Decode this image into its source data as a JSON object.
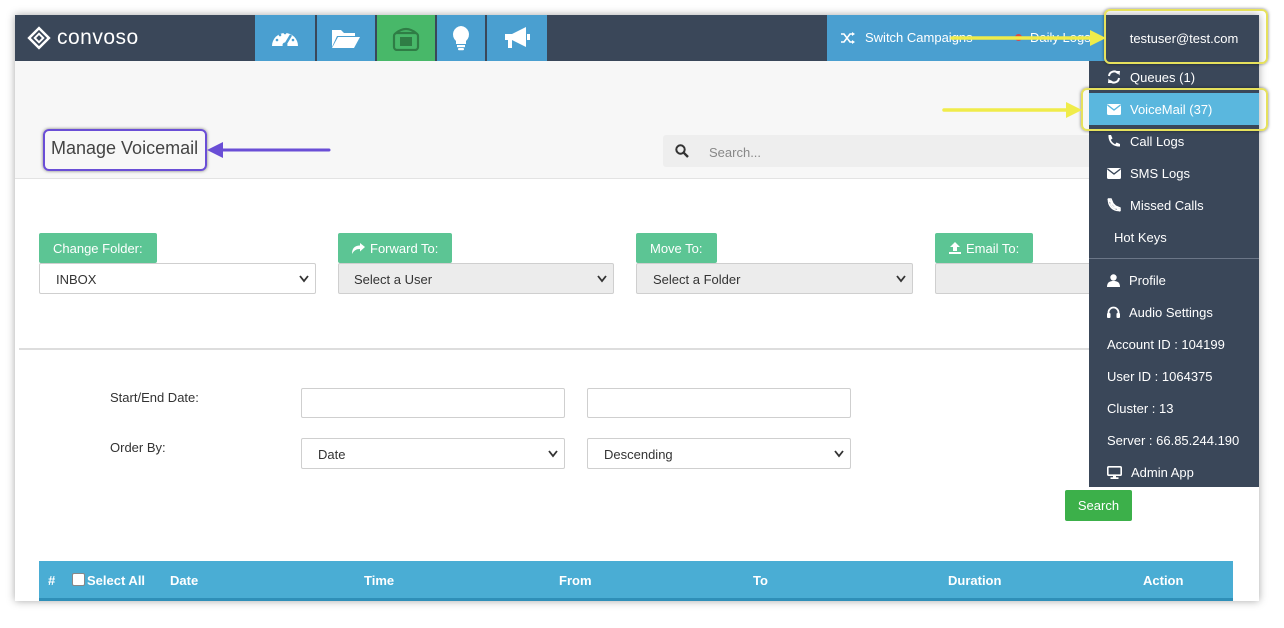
{
  "brand": {
    "name": "convoso"
  },
  "nav": {
    "icons": [
      "dashboard-icon",
      "folder-open-icon",
      "phone-icon",
      "lightbulb-icon",
      "megaphone-icon"
    ],
    "switch_campaigns": "Switch Campaigns",
    "daily_logs": "Daily Logs",
    "user": "testuser@test.com"
  },
  "page": {
    "title": "Manage Voicemail",
    "search_placeholder": "Search..."
  },
  "actions": {
    "change_folder": {
      "label": "Change Folder:",
      "value": "INBOX"
    },
    "forward_to": {
      "label": "Forward To:",
      "value": "Select a User"
    },
    "move_to": {
      "label": "Move To:",
      "value": "Select a Folder"
    },
    "email_to": {
      "label": "Email To:",
      "value": ""
    }
  },
  "filters": {
    "date_label": "Start/End Date:",
    "order_label": "Order By:",
    "order_field": "Date",
    "order_dir": "Descending",
    "search_button": "Search"
  },
  "table": {
    "columns": [
      "#",
      "Select All",
      "Date",
      "Time",
      "From",
      "To",
      "Duration",
      "Action"
    ]
  },
  "dropdown": {
    "items": [
      {
        "label": "Queues (1)",
        "icon": "refresh-icon"
      },
      {
        "label": "VoiceMail (37)",
        "icon": "envelope-icon",
        "highlighted": true
      },
      {
        "label": "Call Logs",
        "icon": "phone-icon"
      },
      {
        "label": "SMS Logs",
        "icon": "envelope-icon"
      },
      {
        "label": "Missed Calls",
        "icon": "phone-slash-icon"
      },
      {
        "label": "Hot Keys",
        "icon": ""
      }
    ],
    "items2": [
      {
        "label": "Profile",
        "icon": "user-icon"
      },
      {
        "label": "Audio Settings",
        "icon": "headphones-icon"
      },
      {
        "label": "Account ID : 104199",
        "icon": ""
      },
      {
        "label": "User ID : 1064375",
        "icon": ""
      },
      {
        "label": "Cluster : 13",
        "icon": ""
      },
      {
        "label": "Server : 66.85.244.190",
        "icon": ""
      },
      {
        "label": "Admin App",
        "icon": "desktop-icon"
      }
    ]
  },
  "colors": {
    "topbar": "#3a4759",
    "nav_blue": "#4a9fd0",
    "nav_green": "#48b869",
    "button_teal": "#5cc594",
    "table_header": "#4aadd4",
    "highlight_yellow": "#e6e15c",
    "highlight_purple": "#6a4ed6"
  }
}
